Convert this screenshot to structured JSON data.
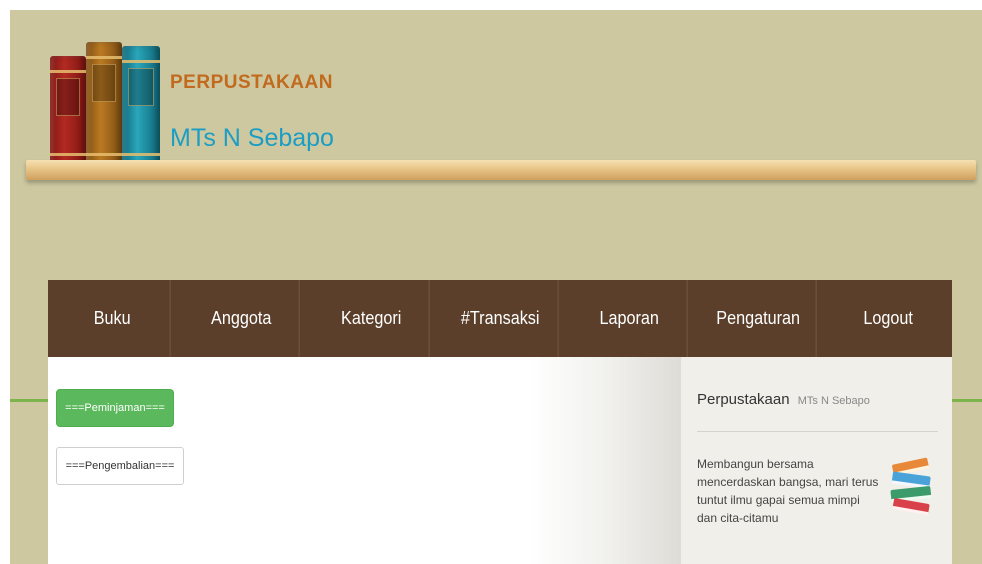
{
  "header": {
    "brand_line1": "PERPUSTAKAAN",
    "brand_line2": "MTs N Sebapo",
    "logo_icon": "books-icon"
  },
  "nav": {
    "items": [
      "Buku",
      "Anggota",
      "Kategori",
      "#Transaksi",
      "Laporan",
      "Pengaturan",
      "Logout"
    ]
  },
  "main": {
    "btn_peminjaman": "===Peminjaman===",
    "btn_pengembalian": "===Pengembalian==="
  },
  "sidebar": {
    "title": "Perpustakaan",
    "subtitle": "MTs N Sebapo",
    "text": "Membangun bersama mencerdaskan bangsa, mari terus tuntut ilmu gapai semua mimpi dan cita-citamu",
    "icon": "book-stack-icon"
  },
  "colors": {
    "background": "#cdc8a0",
    "nav": "#5b3f2b",
    "brand_orange": "#c26a1e",
    "brand_blue": "#1c9dc3",
    "green_button": "#5cb85c"
  }
}
